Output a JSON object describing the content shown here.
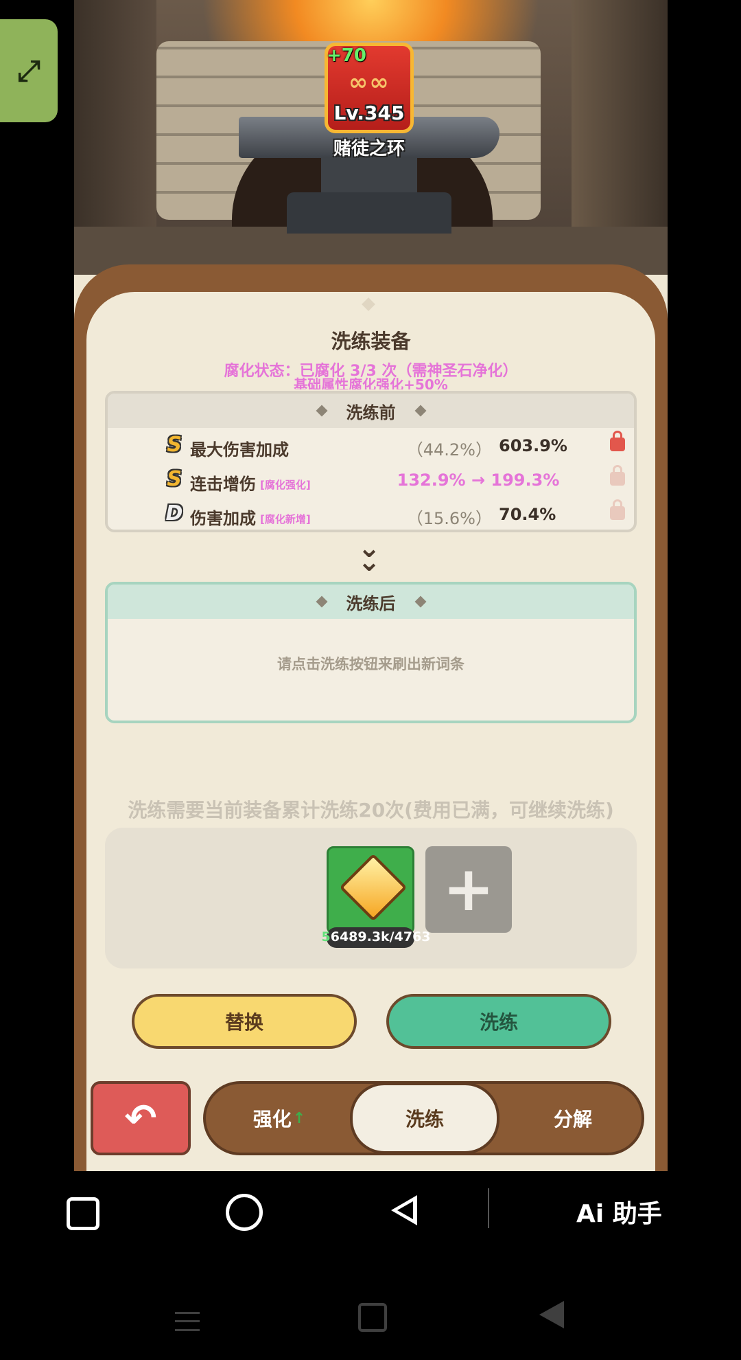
{
  "item": {
    "plus": "+70",
    "rings": "∞∞",
    "level": "Lv.345",
    "name": "赌徒之环"
  },
  "panel": {
    "title": "洗练装备",
    "corruption_status": "腐化状态：已腐化 3/3 次（需神圣石净化）",
    "corruption_bonus": "基础属性腐化强化+50%"
  },
  "before": {
    "header": "洗练前",
    "rows": [
      {
        "grade": "S",
        "name": "最大伤害加成",
        "tag": "",
        "range": "（44.2%）",
        "value": "603.9%",
        "locked": true
      },
      {
        "grade": "S",
        "name": "连击增伤",
        "tag": "[腐化强化]",
        "change": "132.9% → 199.3%",
        "locked": false
      },
      {
        "grade": "D",
        "name": "伤害加成",
        "tag": "[腐化新增]",
        "range": "（15.6%）",
        "value": "70.4%",
        "locked": false
      }
    ]
  },
  "after": {
    "header": "洗练后",
    "hint": "请点击洗练按钮来刷出新词条"
  },
  "cost_note": "洗练需要当前装备累计洗练20次(费用已满，可继续洗练)",
  "material": {
    "count_prefix": "5",
    "count": "6489.3k/47",
    "count_suffix": "63"
  },
  "buttons": {
    "replace": "替换",
    "refine": "洗练"
  },
  "tabs": [
    {
      "label": "强化",
      "badge": "↑"
    },
    {
      "label": "洗练"
    },
    {
      "label": "分解"
    }
  ],
  "side_button_icon": "expand-arrows-icon",
  "navbar": {
    "ai_label": "Ai 助手"
  },
  "colors": {
    "corruption": "#e574d8",
    "refine_button": "#52c197",
    "replace_button": "#f8d870",
    "lock_active": "#e2574c"
  }
}
